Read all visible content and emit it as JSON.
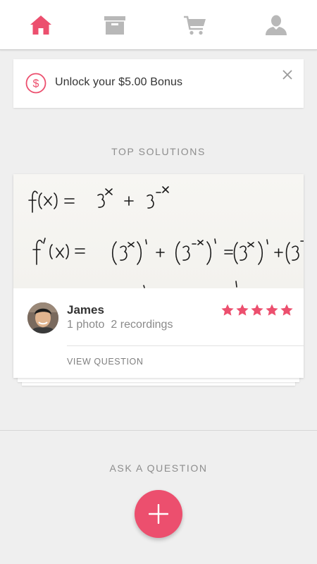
{
  "nav": {
    "items": [
      {
        "name": "home-icon",
        "active": true
      },
      {
        "name": "archive-icon",
        "active": false
      },
      {
        "name": "cart-icon",
        "active": false
      },
      {
        "name": "profile-icon",
        "active": false
      }
    ],
    "active_color": "#ec4f6e",
    "inactive_color": "#b8b8b8"
  },
  "bonus": {
    "text": "Unlock your $5.00 Bonus",
    "icon": "dollar-circle-icon",
    "close_icon": "close-icon"
  },
  "top_solutions": {
    "heading": "TOP SOLUTIONS",
    "cards": [
      {
        "photo_text": {
          "line1_lhs": "f(x) =",
          "line1_rhs": "3x + 3-x",
          "line2_lhs": "f'(x) =",
          "line2_rhs": "(3x)' + (3-x)' = (3x)' + (3"
        },
        "author": "James",
        "photos": "1 photo",
        "recordings": "2 recordings",
        "rating": 5,
        "action_label": "VIEW QUESTION"
      }
    ]
  },
  "ask": {
    "heading": "ASK A QUESTION",
    "button_icon": "plus-icon"
  },
  "colors": {
    "accent": "#ec4f6e",
    "background": "#efefef"
  }
}
